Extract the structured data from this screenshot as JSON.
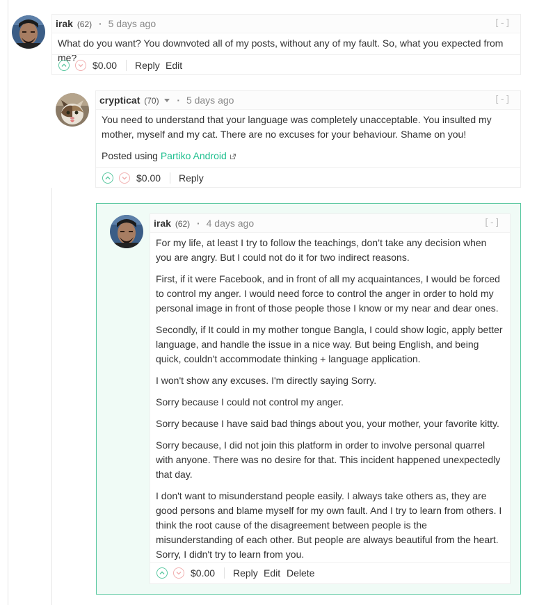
{
  "comments": [
    {
      "author": "irak",
      "reputation": "(62)",
      "time": "5 days ago",
      "collapse": "[-]",
      "paragraphs": [
        "What do you want? You downvoted all of my posts, without any of my fault. So, what you expected from me?"
      ],
      "payout": "$0.00",
      "actions": [
        "Reply",
        "Edit"
      ]
    },
    {
      "author": "crypticat",
      "reputation": "(70)",
      "time": "5 days ago",
      "collapse": "[-]",
      "paragraphs": [
        "You need to understand that your language was completely unacceptable. You insulted my mother, myself and my cat. There are no excuses for your behaviour. Shame on you!"
      ],
      "posted_using": {
        "prefix": "Posted using",
        "link": "Partiko Android"
      },
      "payout": "$0.00",
      "actions": [
        "Reply"
      ]
    },
    {
      "author": "irak",
      "reputation": "(62)",
      "time": "4 days ago",
      "collapse": "[-]",
      "paragraphs": [
        "For my life, at least I try to follow the teachings, don’t take any decision when you are angry. But I could not do it for two indirect reasons.",
        "First, if it were Facebook, and in front of all my acquaintances, I would be forced to control my anger. I would need force to control the anger in order to hold my personal image in front of those people those I know or my near and dear ones.",
        "Secondly, if It could in my mother tongue Bangla, I could show logic, apply better language, and handle the issue in a nice way. But being English, and being quick, couldn't accommodate thinking + language application.",
        "I won't show any excuses. I'm directly saying Sorry.",
        "Sorry because I could not control my anger.",
        "Sorry because I have said bad things about you, your mother, your favorite kitty.",
        "Sorry because, I did not join this platform in order to involve personal quarrel with anyone. There was no desire for that. This incident happened unexpectedly that day.",
        "I don't want to misunderstand people easily. I always take others as, they are good persons and blame myself for my own fault. And I try to learn from others. I think the root cause of the disagreement between people is the misunderstanding of each other. But people are always beautiful from the heart. Sorry, I didn't try to learn from you."
      ],
      "payout": "$0.00",
      "actions": [
        "Reply",
        "Edit",
        "Delete"
      ]
    }
  ],
  "icons": {
    "upvote": "chevron-up-circle-icon",
    "downvote": "chevron-down-circle-icon",
    "external_link": "external-link-icon",
    "dropdown": "caret-down-icon"
  },
  "colors": {
    "accent_green": "#1fbf8f",
    "highlight_bg": "#f0fbf6",
    "highlight_border": "#5bc8a1",
    "downvote": "#f1b0b0"
  }
}
